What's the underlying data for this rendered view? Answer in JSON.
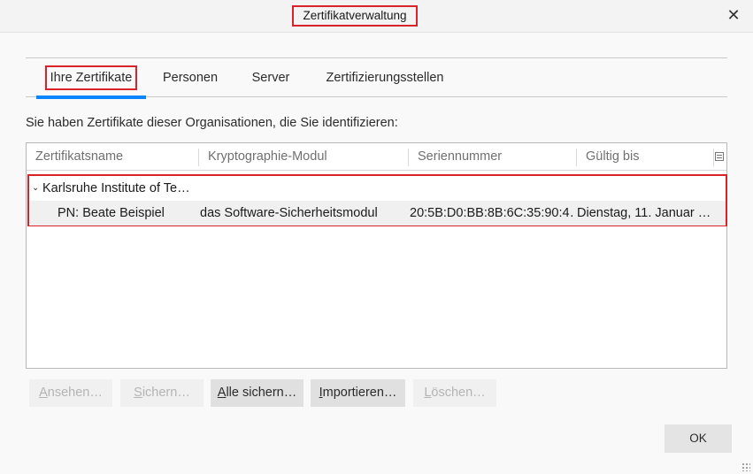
{
  "window": {
    "title": "Zertifikatverwaltung",
    "close_glyph": "✕"
  },
  "tabs": [
    {
      "label": "Ihre Zertifikate",
      "active": true
    },
    {
      "label": "Personen",
      "active": false
    },
    {
      "label": "Server",
      "active": false
    },
    {
      "label": "Zertifizierungsstellen",
      "active": false
    }
  ],
  "intro_text": "Sie haben Zertifikate dieser Organisationen, die Sie identifizieren:",
  "tree": {
    "columns": [
      "Zertifikatsname",
      "Kryptographie-Modul",
      "Seriennummer",
      "Gültig bis"
    ],
    "column_picker_icon": "column-picker-icon",
    "group": {
      "expander_glyph": "⌄",
      "label": "Karlsruhe Institute of Te…",
      "expanded": true
    },
    "rows": [
      {
        "name": "PN: Beate Beispiel",
        "module": "das Software-Sicherheitsmodul",
        "serial": "20:5B:D0:BB:8B:6C:35:90:4…",
        "valid_until": "Dienstag, 11. Januar …"
      }
    ]
  },
  "buttons": {
    "view": {
      "prefix": "",
      "accesskey": "A",
      "rest": "nsehen…",
      "enabled": false
    },
    "backup": {
      "prefix": "",
      "accesskey": "S",
      "rest": "ichern…",
      "enabled": false
    },
    "backup_all": {
      "prefix": "",
      "accesskey": "A",
      "rest": "lle sichern…",
      "enabled": true
    },
    "import": {
      "prefix": "",
      "accesskey": "I",
      "rest": "mportieren…",
      "enabled": true
    },
    "delete": {
      "prefix": "",
      "accesskey": "L",
      "rest": "öschen…",
      "enabled": false
    }
  },
  "ok_label": "OK",
  "colors": {
    "accent": "#0a84ff",
    "annotation_red": "#d8232a"
  }
}
